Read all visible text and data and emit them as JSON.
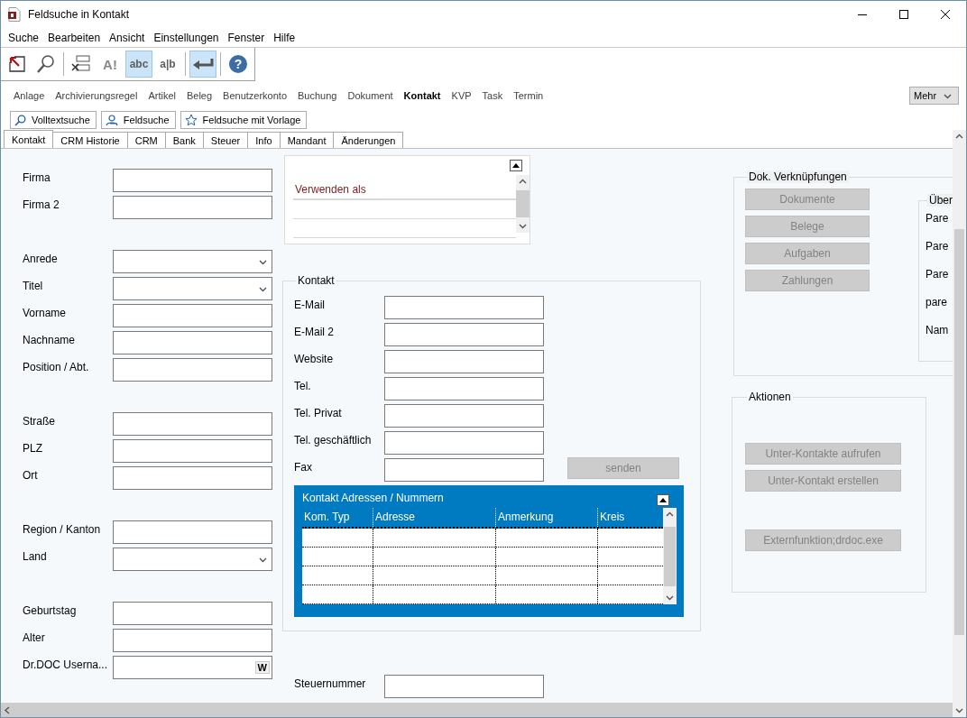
{
  "window": {
    "title": "Feldsuche in Kontakt"
  },
  "menu": [
    "Suche",
    "Bearbeiten",
    "Ansicht",
    "Einstellungen",
    "Fenster",
    "Hilfe"
  ],
  "toolbar": [
    {
      "kind": "exit",
      "selected": false
    },
    {
      "kind": "search",
      "selected": false
    },
    {
      "kind": "separator"
    },
    {
      "kind": "clear",
      "selected": false
    },
    {
      "kind": "case",
      "text": "A!",
      "selected": false
    },
    {
      "kind": "abc",
      "text": "abc",
      "selected": true
    },
    {
      "kind": "split",
      "text": "a|b",
      "selected": false
    },
    {
      "kind": "separator"
    },
    {
      "kind": "enter",
      "selected": true
    },
    {
      "kind": "separator"
    },
    {
      "kind": "help",
      "text": "?",
      "selected": false
    }
  ],
  "modules": [
    {
      "label": "Anlage",
      "selected": false
    },
    {
      "label": "Archivierungsregel",
      "selected": false
    },
    {
      "label": "Artikel",
      "selected": false
    },
    {
      "label": "Beleg",
      "selected": false
    },
    {
      "label": "Benutzerkonto",
      "selected": false
    },
    {
      "label": "Buchung",
      "selected": false
    },
    {
      "label": "Dokument",
      "selected": false
    },
    {
      "label": "Kontakt",
      "selected": true
    },
    {
      "label": "KVP",
      "selected": false
    },
    {
      "label": "Task",
      "selected": false
    },
    {
      "label": "Termin",
      "selected": false
    }
  ],
  "more": {
    "label": "Mehr"
  },
  "search_modes": [
    {
      "kind": "fulltext",
      "label": "Volltextsuche"
    },
    {
      "kind": "field",
      "label": "Feldsuche"
    },
    {
      "kind": "template",
      "label": "Feldsuche mit Vorlage"
    }
  ],
  "tabs": [
    {
      "label": "Kontakt",
      "selected": true
    },
    {
      "label": "CRM Historie",
      "selected": false
    },
    {
      "label": "CRM",
      "selected": false
    },
    {
      "label": "Bank",
      "selected": false
    },
    {
      "label": "Steuer",
      "selected": false
    },
    {
      "label": "Info",
      "selected": false
    },
    {
      "label": "Mandant",
      "selected": false
    },
    {
      "label": "Änderungen",
      "selected": false
    }
  ],
  "left_groups": [
    [
      {
        "label": "Firma",
        "kind": "text"
      },
      {
        "label": "Firma 2",
        "kind": "text"
      }
    ],
    [
      {
        "label": "Anrede",
        "kind": "dropdown"
      },
      {
        "label": "Titel",
        "kind": "dropdown"
      },
      {
        "label": "Vorname",
        "kind": "text"
      },
      {
        "label": "Nachname",
        "kind": "text"
      },
      {
        "label": "Position / Abt.",
        "kind": "text"
      }
    ],
    [
      {
        "label": "Straße",
        "kind": "text"
      },
      {
        "label": "PLZ",
        "kind": "text"
      },
      {
        "label": "Ort",
        "kind": "text"
      }
    ],
    [
      {
        "label": "Region / Kanton",
        "kind": "text"
      },
      {
        "label": "Land",
        "kind": "dropdown"
      }
    ],
    [
      {
        "label": "Geburtstag",
        "kind": "text"
      },
      {
        "label": "Alter",
        "kind": "text"
      },
      {
        "label": "Dr.DOC Userna...",
        "kind": "lookup",
        "button": "W"
      }
    ]
  ],
  "use_as": {
    "header": "Verwenden als"
  },
  "contact": {
    "title": "Kontakt",
    "fields": [
      {
        "label": "E-Mail"
      },
      {
        "label": "E-Mail 2"
      },
      {
        "label": "Website"
      },
      {
        "label": "Tel."
      },
      {
        "label": "Tel. Privat"
      },
      {
        "label": "Tel. geschäftlich"
      },
      {
        "label": "Fax",
        "action": {
          "label": "senden",
          "disabled": true
        }
      }
    ],
    "table": {
      "title": "Kontakt Adressen / Nummern",
      "columns": [
        "Kom. Typ",
        "Adresse",
        "Anmerkung",
        "Kreis"
      ]
    }
  },
  "tax": {
    "label": "Steuernummer"
  },
  "doc_links": {
    "title": "Dok. Verknüpfungen",
    "buttons": [
      {
        "label": "Dokumente",
        "disabled": true
      },
      {
        "label": "Belege",
        "disabled": true
      },
      {
        "label": "Aufgaben",
        "disabled": true
      },
      {
        "label": "Zahlungen",
        "disabled": true
      }
    ]
  },
  "overview": {
    "title": "Über",
    "labels": [
      "Pare",
      "Pare",
      "Pare",
      "pare",
      "Nam"
    ]
  },
  "actions": {
    "title": "Aktionen",
    "buttons": [
      {
        "label": "Unter-Kontakte aufrufen",
        "disabled": true
      },
      {
        "label": "Unter-Kontakt erstellen",
        "disabled": true
      },
      {
        "label": "Externfunktion;drdoc.exe",
        "disabled": true
      }
    ]
  }
}
